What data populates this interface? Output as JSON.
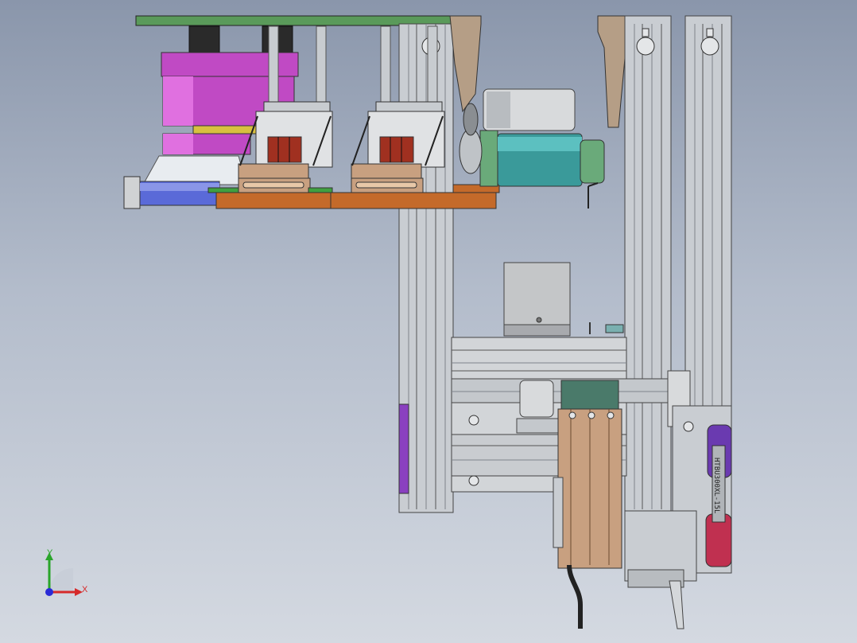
{
  "viewport": {
    "background_top": "#8a96ab",
    "background_bottom": "#d4d9e1"
  },
  "model": {
    "belt_label": "HTBU300XL-15L",
    "colors": {
      "top_plate": "#5a9a5a",
      "bracket": "#b59e86",
      "frame": "#c9cdd2",
      "frame_dark": "#7e848b",
      "bowl": "#c04ac4",
      "bowl_light": "#e070e0",
      "base_plate": "#c46a2a",
      "motor_teal": "#3a9a9a",
      "motor_green": "#6aaa7a",
      "motor_silver": "#d8dadc",
      "pulley": "#6a3ab0",
      "pulley_red": "#c03050",
      "blue_plate": "#5a6ad8",
      "carriage_brown": "#c8a080",
      "gripper_red": "#a03020"
    }
  },
  "triad": {
    "y_label": "Y",
    "x_label": "X",
    "y_color": "#2aa52a",
    "x_color": "#d62a2a",
    "z_color": "#2a2ad6"
  }
}
